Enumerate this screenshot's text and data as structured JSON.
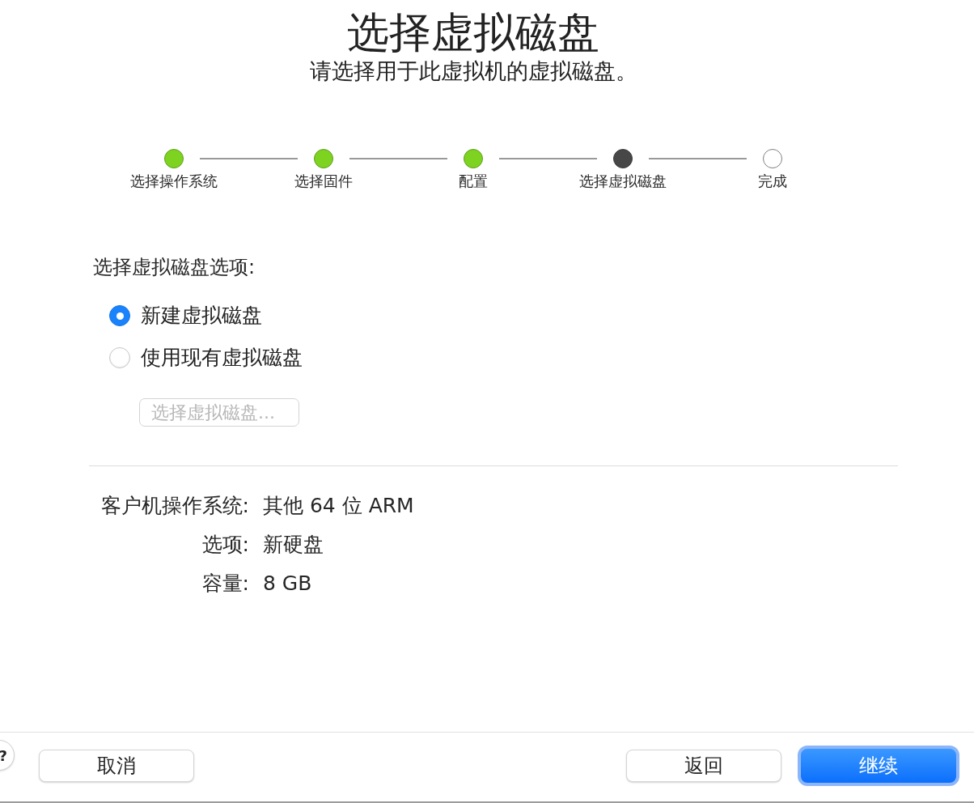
{
  "header": {
    "title": "选择虚拟磁盘",
    "subtitle": "请选择用于此虚拟机的虚拟磁盘。"
  },
  "steps": [
    {
      "label": "选择操作系统",
      "completed": true,
      "current": false
    },
    {
      "label": "选择固件",
      "completed": true,
      "current": false
    },
    {
      "label": "配置",
      "completed": true,
      "current": false
    },
    {
      "label": "选择虚拟磁盘",
      "completed": false,
      "current": true
    },
    {
      "label": "完成",
      "completed": false,
      "current": false
    }
  ],
  "disk_options": {
    "heading": "选择虚拟磁盘选项:",
    "options": [
      {
        "label": "新建虚拟磁盘",
        "selected": true
      },
      {
        "label": "使用现有虚拟磁盘",
        "selected": false
      }
    ],
    "choose_button": {
      "label": "选择虚拟磁盘...",
      "disabled": true
    }
  },
  "summary": [
    {
      "label": "客户机操作系统:",
      "value": "其他 64 位 ARM"
    },
    {
      "label": "选项:",
      "value": "新硬盘"
    },
    {
      "label": "容量:",
      "value": "8 GB"
    }
  ],
  "footer": {
    "help_button": "?",
    "buttons": [
      {
        "label": "取消",
        "kind": "default"
      },
      {
        "label": "返回",
        "kind": "default"
      },
      {
        "label": "继续",
        "kind": "primary"
      }
    ]
  }
}
